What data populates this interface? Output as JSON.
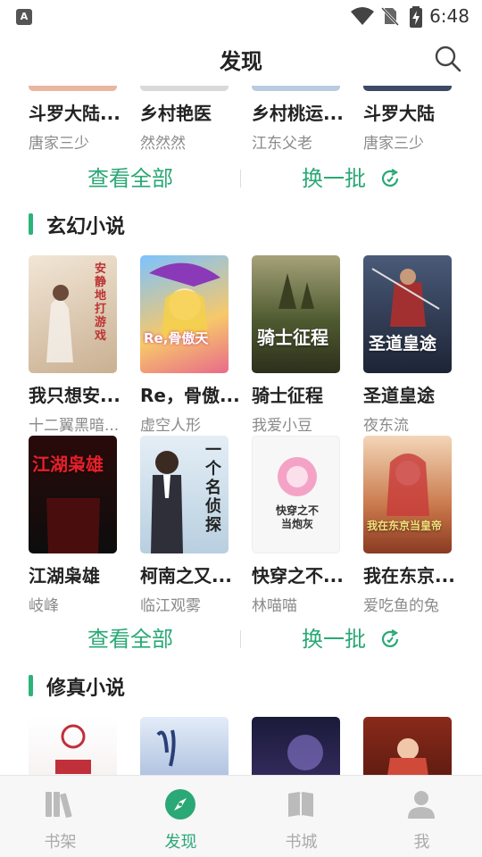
{
  "status_bar": {
    "app_badge": "A",
    "time": "6:48"
  },
  "header": {
    "title": "发现"
  },
  "top_row": [
    {
      "title": "斗罗大陆...",
      "author": "唐家三少"
    },
    {
      "title": "乡村艳医",
      "author": "然然然"
    },
    {
      "title": "乡村桃运...",
      "author": "江东父老"
    },
    {
      "title": "斗罗大陆",
      "author": "唐家三少"
    }
  ],
  "actions": {
    "view_all": "查看全部",
    "refresh": "换一批"
  },
  "sections": [
    {
      "title": "玄幻小说",
      "books": [
        {
          "title": "我只想安...",
          "author": "十二翼黑暗...",
          "cover_text": "安静地打游戏",
          "cover_color": "#e8d9c4"
        },
        {
          "title": "Re，骨傲...",
          "author": "虚空人形",
          "cover_text": "Re,骨傲天",
          "cover_color": "#6fa8e8"
        },
        {
          "title": "骑士征程",
          "author": "我爱小豆",
          "cover_text": "骑士征程",
          "cover_color": "#5a6b3a"
        },
        {
          "title": "圣道皇途",
          "author": "夜东流",
          "cover_text": "圣道皇途",
          "cover_color": "#2a3a55"
        },
        {
          "title": "江湖枭雄",
          "author": "岐峰",
          "cover_text": "江湖枭雄",
          "cover_color": "#1a1a1a"
        },
        {
          "title": "柯南之又...",
          "author": "临江观雾",
          "cover_text": "一个名侦探",
          "cover_color": "#dfe7ef"
        },
        {
          "title": "快穿之不...",
          "author": "林喵喵",
          "cover_text": "快穿之不当炮灰",
          "cover_color": "#f6f6f6"
        },
        {
          "title": "我在东京...",
          "author": "爱吃鱼的兔",
          "cover_text": "我在东京当皇帝",
          "cover_color": "#d89a6a"
        }
      ]
    },
    {
      "title": "修真小说"
    }
  ],
  "bottom_nav": [
    {
      "label": "书架",
      "icon": "bookshelf-icon"
    },
    {
      "label": "发现",
      "icon": "compass-icon"
    },
    {
      "label": "书城",
      "icon": "book-icon"
    },
    {
      "label": "我",
      "icon": "user-icon"
    }
  ],
  "colors": {
    "accent": "#2aa876",
    "muted": "#8a8a8a"
  }
}
